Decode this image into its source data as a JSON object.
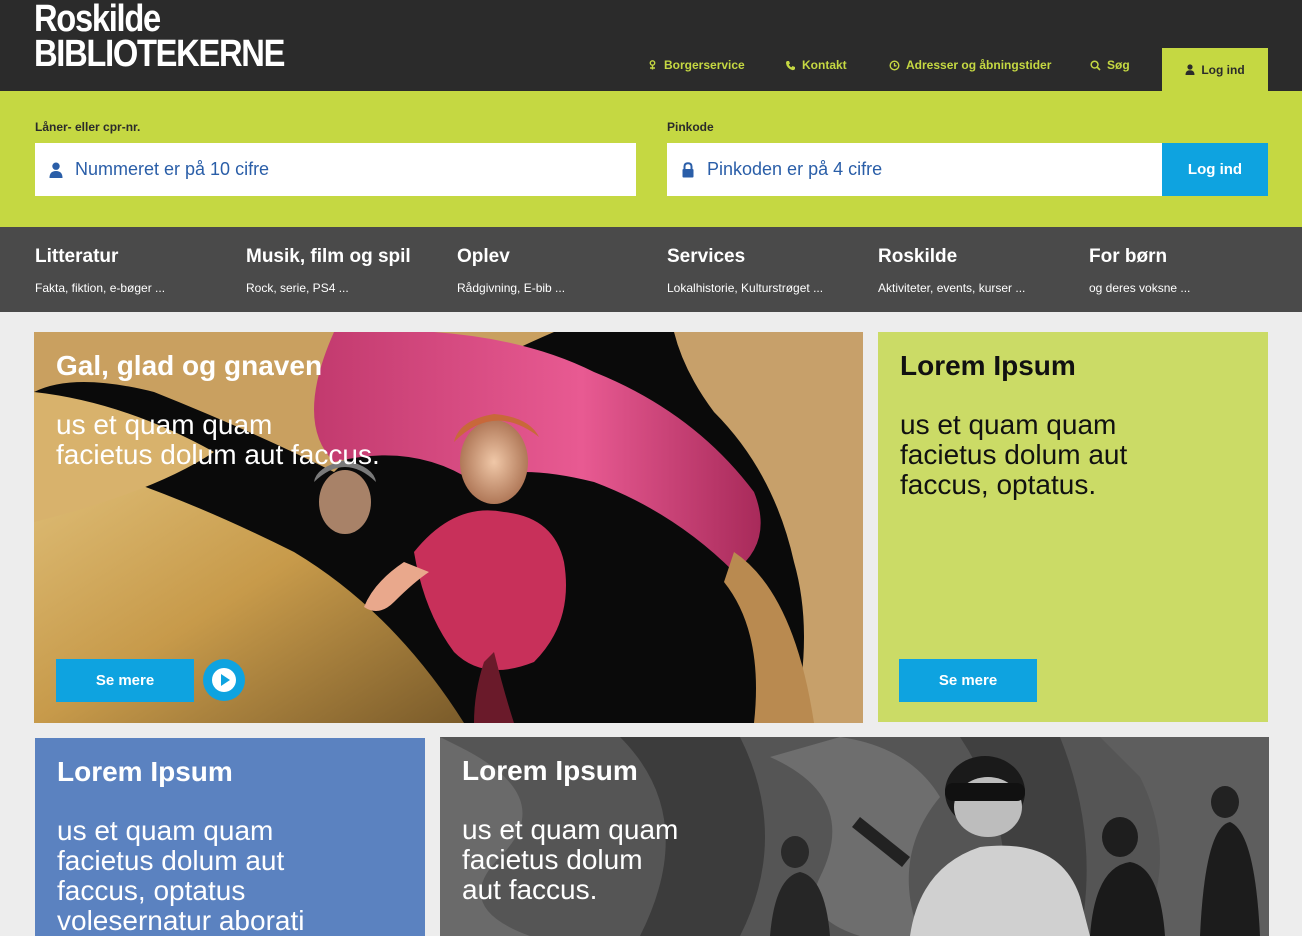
{
  "brand": {
    "line1": "Roskilde",
    "line2": "BIBLIOTEKERNE"
  },
  "topnav": {
    "borgerservice": "Borgerservice",
    "kontakt": "Kontakt",
    "adresser": "Adresser og åbningstider",
    "sog": "Søg",
    "login": "Log ind"
  },
  "login_form": {
    "user_label": "Låner- eller cpr-nr.",
    "user_placeholder": "Nummeret er på 10 cifre",
    "pin_label": "Pinkode",
    "pin_placeholder": "Pinkoden er på 4 cifre",
    "submit": "Log ind"
  },
  "categories": [
    {
      "title": "Litteratur",
      "sub": "Fakta, fiktion, e-bøger ..."
    },
    {
      "title": "Musik, film og spil",
      "sub": "Rock, serie, PS4 ..."
    },
    {
      "title": "Oplev",
      "sub": "Rådgivning, E-bib ..."
    },
    {
      "title": "Services",
      "sub": "Lokalhistorie, Kulturstrøget ..."
    },
    {
      "title": "Roskilde",
      "sub": "Aktiviteter, events, kurser ..."
    },
    {
      "title": "For børn",
      "sub": "og deres voksne ..."
    }
  ],
  "hero": {
    "title": "Gal, glad og gnaven",
    "body_line1": "us et quam quam",
    "body_line2": "facietus dolum aut faccus.",
    "button": "Se mere"
  },
  "green_card": {
    "title": "Lorem Ipsum",
    "body_line1": "us et quam quam",
    "body_line2": "facietus dolum aut",
    "body_line3": "faccus, optatus.",
    "button": "Se mere"
  },
  "blue_card": {
    "title": "Lorem Ipsum",
    "body_line1": "us et quam quam",
    "body_line2": "facietus dolum aut",
    "body_line3": "faccus, optatus",
    "body_line4": "volesernatur aborati"
  },
  "photo_card": {
    "title": "Lorem Ipsum",
    "body_line1": "us et quam quam",
    "body_line2": "facietus dolum",
    "body_line3": "aut faccus."
  },
  "colors": {
    "header": "#2b2b2b",
    "accent_green": "#c5d842",
    "button_blue": "#0ea3e0",
    "link_blue": "#2a5ea8",
    "card_blue": "#5b82c0"
  }
}
